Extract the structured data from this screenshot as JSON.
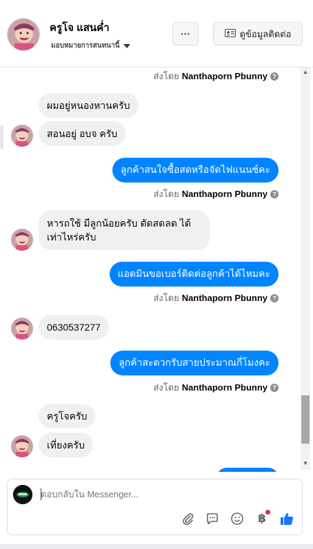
{
  "header": {
    "name": "ครูโจ แสนค่ำ",
    "assign_label": "มอบหมายการสนทนานี้",
    "more_label": "···",
    "info_button": "ดูข้อมูลติดต่อ"
  },
  "messages": [
    {
      "type": "sent_by",
      "prefix": "ส่งโดย",
      "author": "Nanthaporn Pbunny"
    },
    {
      "type": "in",
      "text": "ผมอยู่หนองหานครับ"
    },
    {
      "type": "in",
      "text": "สอนอยู่ อบจ ครับ"
    },
    {
      "type": "out",
      "text": "ลูกค้าสนใจซื้อสดหรือจัดไฟแนนซ์คะ"
    },
    {
      "type": "sent_by",
      "prefix": "ส่งโดย",
      "author": "Nanthaporn Pbunny"
    },
    {
      "type": "in",
      "text": "หารถใช้  มีลูกน้อยครับ  ดัดสดลด ได้เท่าไหร่ครับ"
    },
    {
      "type": "out",
      "text": "แอดมินขอเบอร์ติดต่อลูกค้าได้ไหมคะ"
    },
    {
      "type": "sent_by",
      "prefix": "ส่งโดย",
      "author": "Nanthaporn Pbunny"
    },
    {
      "type": "in",
      "text": "0630537277"
    },
    {
      "type": "out",
      "text": "ลูกค้าสะดวกรับสายประมาณกี่โมงคะ"
    },
    {
      "type": "sent_by",
      "prefix": "ส่งโดย",
      "author": "Nanthaporn Pbunny"
    },
    {
      "type": "in",
      "text": "ครูโจครับ"
    },
    {
      "type": "in",
      "text": "เที่ยงครับ"
    }
  ],
  "composer": {
    "placeholder": "ตอบกลับใน Messenger..."
  },
  "colors": {
    "outgoing": "#0084ff",
    "incoming": "#f0f0f0",
    "like": "#1877f2"
  }
}
